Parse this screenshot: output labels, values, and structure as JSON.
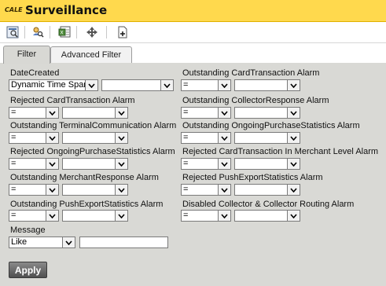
{
  "header": {
    "logo_text": "CALE",
    "title": "Surveillance"
  },
  "toolbar": {
    "buttons": [
      {
        "icon": "preview-icon"
      },
      {
        "icon": "search-user-icon"
      },
      {
        "icon": "excel-export-icon"
      },
      {
        "icon": "move-icon"
      },
      {
        "icon": "new-document-icon"
      }
    ]
  },
  "tabs": [
    {
      "label": "Filter",
      "active": true
    },
    {
      "label": "Advanced Filter",
      "active": false
    }
  ],
  "filters": {
    "date_created": {
      "label": "DateCreated",
      "op": "Dynamic Time Span",
      "value": ""
    },
    "outstanding_cardtransaction": {
      "label": "Outstanding CardTransaction Alarm",
      "op": "=",
      "value": ""
    },
    "rejected_cardtransaction": {
      "label": "Rejected CardTransaction Alarm",
      "op": "=",
      "value": ""
    },
    "outstanding_collectorresponse": {
      "label": "Outstanding CollectorResponse Alarm",
      "op": "=",
      "value": ""
    },
    "outstanding_terminalcommunication": {
      "label": "Outstanding TerminalCommunication Alarm",
      "op": "=",
      "value": ""
    },
    "outstanding_ongoingpurchase": {
      "label": "Outstanding OngoingPurchaseStatistics Alarm",
      "op": "=",
      "value": ""
    },
    "rejected_ongoingpurchase": {
      "label": "Rejected OngoingPurchaseStatistics Alarm",
      "op": "=",
      "value": ""
    },
    "rejected_cardtransaction_merchant": {
      "label": "Rejected CardTransaction In Merchant Level Alarm",
      "op": "=",
      "value": ""
    },
    "outstanding_merchantresponse": {
      "label": "Outstanding MerchantResponse Alarm",
      "op": "=",
      "value": ""
    },
    "rejected_pushexport": {
      "label": "Rejected PushExportStatistics Alarm",
      "op": "=",
      "value": ""
    },
    "outstanding_pushexport": {
      "label": "Outstanding PushExportStatistics Alarm",
      "op": "=",
      "value": ""
    },
    "disabled_collector": {
      "label": "Disabled Collector & Collector Routing Alarm",
      "op": "=",
      "value": ""
    },
    "message": {
      "label": "Message",
      "op": "Like",
      "value": ""
    }
  },
  "apply_label": "Apply",
  "colors": {
    "title_bar": "#ffd94d",
    "panel": "#d9d9d5",
    "button": "#4f4f4f"
  }
}
